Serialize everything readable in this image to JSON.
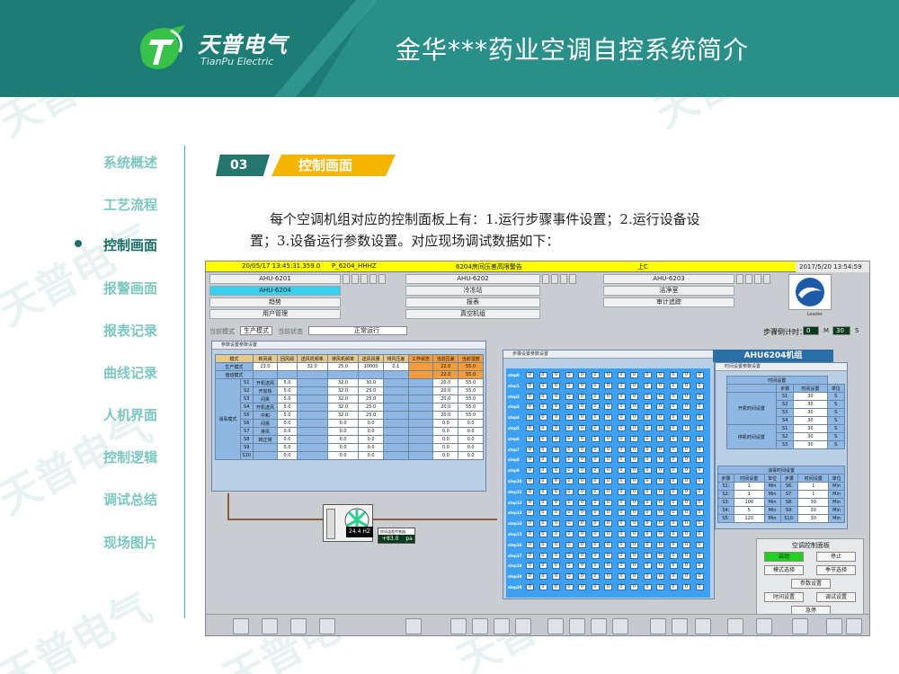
{
  "header": {
    "logo_cn": "天普电气",
    "logo_en": "TianPu Electric",
    "title": "金华***药业空调自控系统简介"
  },
  "sidebar": {
    "items": [
      {
        "label": "系统概述"
      },
      {
        "label": "工艺流程"
      },
      {
        "label": "控制画面",
        "active": true
      },
      {
        "label": "报警画面"
      },
      {
        "label": "报表记录"
      },
      {
        "label": "曲线记录"
      },
      {
        "label": "人机界面"
      },
      {
        "label": "控制逻辑"
      },
      {
        "label": "调试总结"
      },
      {
        "label": "现场图片"
      }
    ]
  },
  "section": {
    "number": "03",
    "label": "控制画面"
  },
  "description": {
    "line1": "每个空调机组对应的控制面板上有：1.运行步骤事件设置；2.运行设备设",
    "line2": "置；3.设备运行参数设置。对应现场调试数据如下："
  },
  "screenshot": {
    "top_time": "20/05/17 13:45:31.359.0",
    "top_tag": "P_6204_HHHZ",
    "top_alarm": "6204房间压差高限警告",
    "top_right": "上C",
    "datetime": "2017/5/20 13:54:59",
    "tabs_row1": [
      "AHU-6201",
      "AHU-6202",
      "AHU-6203"
    ],
    "tabs_row2": [
      "AHU-6204",
      "冷冻站",
      "洁净室"
    ],
    "tabs_row3": [
      "趋势",
      "报表",
      "审计追踪"
    ],
    "tabs_row4": [
      "用户管理",
      "真空机组"
    ],
    "logo_label": "Leader",
    "status_label1": "当前模式",
    "status_mode": "生产模式",
    "status_label2": "当前状态",
    "status_state": "正常运行",
    "countdown_label": "步骤倒计时：",
    "countdown_m_val": "0",
    "countdown_s_val": "30",
    "countdown_m": "M",
    "countdown_s": "S",
    "panel1_title": "参数设置参数设置",
    "panel1_headers": [
      "模式",
      "新风阀",
      "回风阀",
      "送风机频率",
      "排风机频率",
      "送风风量",
      "排风压差"
    ],
    "panel1_side": [
      "工作状态",
      "当前压差",
      "当前湿度"
    ],
    "panel1_side_vals": [
      "22.0",
      "55.0"
    ],
    "panel1_row_prod": [
      "生产模式",
      "23.0",
      "",
      "32.0",
      "25.0",
      "10000",
      "0.1"
    ],
    "panel1_row_maint": "值班模式",
    "panel1_group": "消毒模式",
    "panel1_steps": [
      {
        "s": "S1",
        "name": "开机送风",
        "a": "5.0",
        "b": "32.0",
        "c": "30.0",
        "d": "20.0",
        "e": "55.0"
      },
      {
        "s": "S2",
        "name": "开加热",
        "a": "5.0",
        "b": "32.0",
        "c": "25.0",
        "d": "20.0",
        "e": "55.0"
      },
      {
        "s": "S3",
        "name": "闷熏",
        "a": "5.0",
        "b": "32.0",
        "c": "25.0",
        "d": "20.0",
        "e": "55.0"
      },
      {
        "s": "S4",
        "name": "开机送风",
        "a": "5.0",
        "b": "32.0",
        "c": "25.0",
        "d": "20.0",
        "e": "55.0"
      },
      {
        "s": "S5",
        "name": "中和",
        "a": "5.0",
        "b": "32.0",
        "c": "25.0",
        "d": "20.0",
        "e": "55.0"
      },
      {
        "s": "S6",
        "name": "闷熏",
        "a": "0.0",
        "b": "0.0",
        "c": "0.0",
        "d": "0.0",
        "e": "0.0"
      },
      {
        "s": "S7",
        "name": "排风",
        "a": "0.0",
        "b": "0.0",
        "c": "0.0",
        "d": "0.0",
        "e": "0.0"
      },
      {
        "s": "S8",
        "name": "转正常",
        "a": "0.0",
        "b": "0.0",
        "c": "0.0",
        "d": "0.0",
        "e": "0.0"
      },
      {
        "s": "S9",
        "name": "",
        "a": "0.0",
        "b": "0.0",
        "c": "0.0",
        "d": "0.0",
        "e": "0.0"
      },
      {
        "s": "S10",
        "name": "",
        "a": "0.0",
        "b": "0.0",
        "c": "0.0",
        "d": "0.0",
        "e": "0.0"
      }
    ],
    "panel2_title": "步骤设置参数设置",
    "panel2_rows": [
      "step0",
      "step1",
      "step2",
      "step3",
      "step4",
      "step5",
      "step6",
      "step7",
      "step8",
      "step9",
      "step10",
      "step11",
      "step12",
      "step13",
      "step14",
      "step15",
      "step16",
      "step17",
      "step18",
      "step19",
      "step20"
    ],
    "panel2_cell": "0",
    "ahu_title": "AHU6204机组",
    "panel3_title": "时间设置参数设置",
    "panel3_header1": "时间设置",
    "panel3_cols": [
      "步骤",
      "时间设置",
      "单位"
    ],
    "panel3_group1": "开机时间设置",
    "panel3_group2": "停机时间设置",
    "panel3_rows_a": [
      {
        "s": "S1",
        "v": "30",
        "u": "S"
      },
      {
        "s": "S2",
        "v": "30",
        "u": "S"
      },
      {
        "s": "S3",
        "v": "30",
        "u": "S"
      },
      {
        "s": "S4",
        "v": "30",
        "u": "S"
      },
      {
        "s": "S1",
        "v": "30",
        "u": "S"
      },
      {
        "s": "S2",
        "v": "30",
        "u": "S"
      },
      {
        "s": "S3",
        "v": "30",
        "u": "S"
      }
    ],
    "panel3_header2": "消毒时间设置",
    "panel3_rows_b": [
      {
        "s": "S1:",
        "v": "1",
        "u": "Min",
        "s2": "S6:",
        "v2": "1",
        "u2": "Min"
      },
      {
        "s": "S2:",
        "v": "1",
        "u": "Min",
        "s2": "S7:",
        "v2": "1",
        "u2": "Min"
      },
      {
        "s": "S3:",
        "v": "100",
        "u": "Min",
        "s2": "S8:",
        "v2": "30",
        "u2": "Min"
      },
      {
        "s": "S4:",
        "v": "5",
        "u": "Min",
        "s2": "S9:",
        "v2": "30",
        "u2": "Min"
      },
      {
        "s": "S5:",
        "v": "120",
        "u": "Min",
        "s2": "S10:",
        "v2": "30",
        "u2": "Min"
      }
    ],
    "control_title": "空调控制面板",
    "control_buttons": [
      "启动",
      "停止",
      "模式选择",
      "季节选择",
      "参数设置",
      "时间设置",
      "调试设置",
      "急停"
    ],
    "unit_freq": "24.4 HZ",
    "readout_label": "房间温差传感器",
    "readout_value": "+83.0",
    "readout_unit": "pa"
  },
  "watermark": "天普电气",
  "colors": {
    "teal": "#2a8f88",
    "orange": "#f5b400",
    "dark_teal": "#24766f"
  }
}
